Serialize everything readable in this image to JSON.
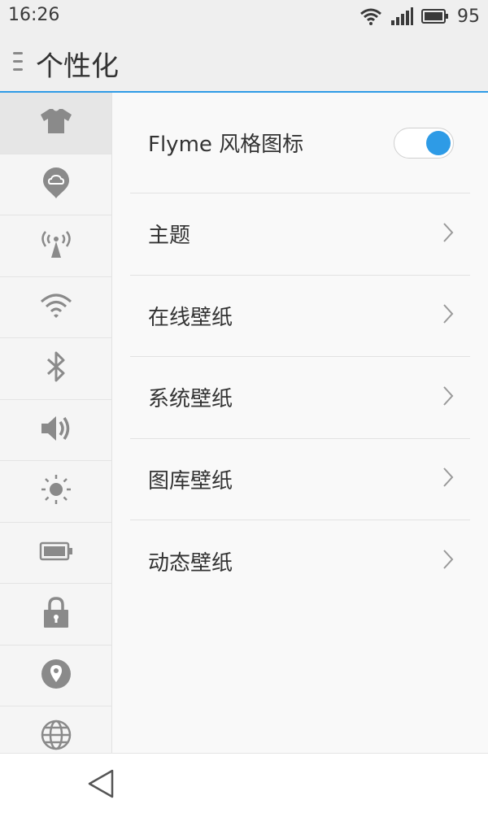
{
  "status": {
    "time": "16:26",
    "battery": "95"
  },
  "header": {
    "title": "个性化"
  },
  "sidebar": {
    "items": [
      {
        "icon": "tshirt-icon"
      },
      {
        "icon": "cloud-icon"
      },
      {
        "icon": "hotspot-icon"
      },
      {
        "icon": "wifi-icon"
      },
      {
        "icon": "bluetooth-icon"
      },
      {
        "icon": "volume-icon"
      },
      {
        "icon": "brightness-icon"
      },
      {
        "icon": "battery-icon"
      },
      {
        "icon": "lock-icon"
      },
      {
        "icon": "location-icon"
      },
      {
        "icon": "globe-icon"
      }
    ]
  },
  "settings": {
    "flyme_icons": {
      "label": "Flyme 风格图标",
      "enabled": true
    },
    "theme": "主题",
    "online_wallpaper": "在线壁纸",
    "system_wallpaper": "系统壁纸",
    "gallery_wallpaper": "图库壁纸",
    "live_wallpaper": "动态壁纸"
  },
  "colors": {
    "accent": "#2e9be6",
    "icon_gray": "#8a8a8a"
  }
}
